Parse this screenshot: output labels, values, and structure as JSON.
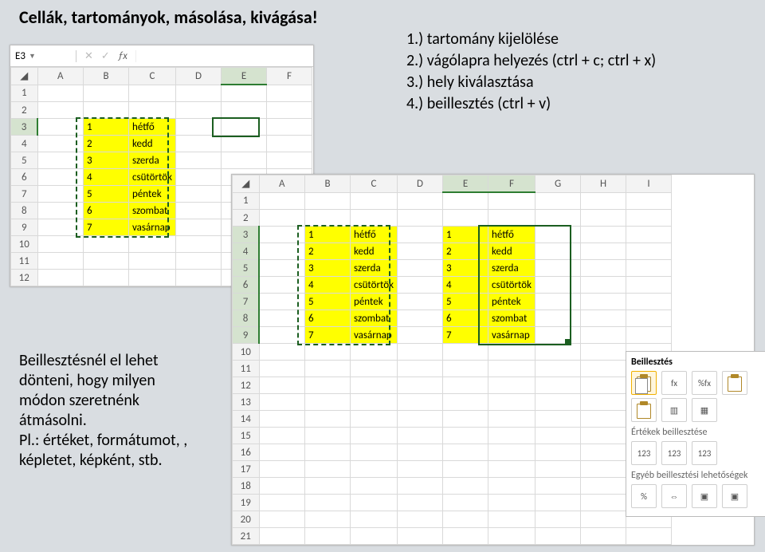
{
  "title": "Cellák, tartományok, másolása, kivágása!",
  "steps": {
    "s1": "1.) tartomány kijelölése",
    "s2": "2.) vágólapra helyezés (ctrl + c; ctrl + x)",
    "s3": "3.) hely kiválasztása",
    "s4": "4.) beillesztés (ctrl + v)"
  },
  "note": {
    "l1": "Beillesztésnél el lehet",
    "l2": "dönteni, hogy milyen",
    "l3": "módon szeretnénk",
    "l4": "átmásolni.",
    "l5": "Pl.: értéket, formátumot, ,",
    "l6": "képletet, képként, stb."
  },
  "sheet1": {
    "namebox": "E3",
    "cols": [
      "A",
      "B",
      "C",
      "D",
      "E",
      "F"
    ],
    "rows": [
      "1",
      "2",
      "3",
      "4",
      "5",
      "6",
      "7",
      "8",
      "9",
      "10",
      "11",
      "12"
    ],
    "data": [
      {
        "b": "1",
        "c": "hétfő"
      },
      {
        "b": "2",
        "c": "kedd"
      },
      {
        "b": "3",
        "c": "szerda"
      },
      {
        "b": "4",
        "c": "csütörtök"
      },
      {
        "b": "5",
        "c": "péntek"
      },
      {
        "b": "6",
        "c": "szombat"
      },
      {
        "b": "7",
        "c": "vasárnap"
      }
    ],
    "sel_col": "E"
  },
  "sheet2": {
    "cols": [
      "A",
      "B",
      "C",
      "D",
      "E",
      "F",
      "G",
      "H",
      "I"
    ],
    "rows": [
      "1",
      "2",
      "3",
      "4",
      "5",
      "6",
      "7",
      "8",
      "9",
      "10",
      "11",
      "12",
      "13",
      "14",
      "15",
      "16",
      "17",
      "18",
      "19",
      "20",
      "21"
    ],
    "data": [
      {
        "b": "1",
        "c": "hétfő",
        "e": "1",
        "f": "hétfő"
      },
      {
        "b": "2",
        "c": "kedd",
        "e": "2",
        "f": "kedd"
      },
      {
        "b": "3",
        "c": "szerda",
        "e": "3",
        "f": "szerda"
      },
      {
        "b": "4",
        "c": "csütörtök",
        "e": "4",
        "f": "csütörtök"
      },
      {
        "b": "5",
        "c": "péntek",
        "e": "5",
        "f": "péntek"
      },
      {
        "b": "6",
        "c": "szombat",
        "e": "6",
        "f": "szombat"
      },
      {
        "b": "7",
        "c": "vasárnap",
        "e": "7",
        "f": "vasárnap"
      }
    ]
  },
  "paste": {
    "title": "Beillesztés",
    "sec_values": "Értékek beillesztése",
    "sec_other": "Egyéb beillesztési lehetőségek",
    "icons": {
      "fx": "fx",
      "pctfx": "%fx",
      "blank": "",
      "link": "⇔",
      "tbl": "▦",
      "cols": "▥",
      "v123a": "123",
      "v123b": "123",
      "v123c": "123",
      "opct": "%",
      "olink": "⇔",
      "oimg": "▣"
    }
  }
}
